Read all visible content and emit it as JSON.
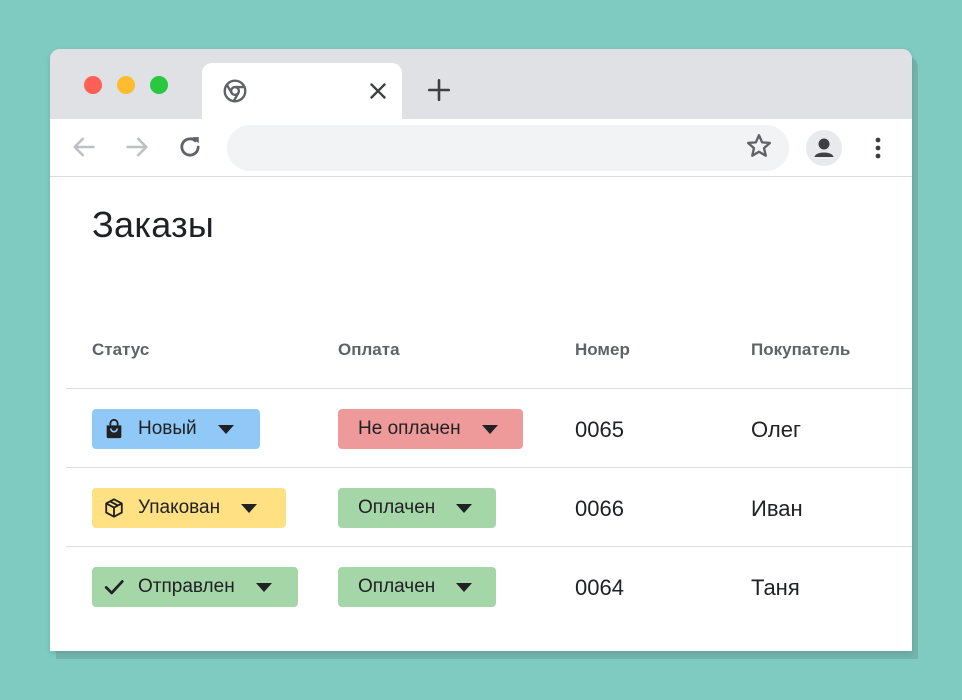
{
  "browser": {
    "tab_favicon": "chrome-icon",
    "tab_close": "close-icon",
    "new_tab": "plus-icon",
    "nav": [
      "back-arrow-icon",
      "forward-arrow-icon",
      "reload-icon"
    ],
    "address_value": "",
    "bookmark": "star-icon",
    "profile": "account-icon",
    "menu": "more-vert-icon"
  },
  "page": {
    "title": "Заказы",
    "columns": [
      "Статус",
      "Оплата",
      "Номер",
      "Покупатель"
    ],
    "rows": [
      {
        "status": {
          "label": "Новый",
          "icon": "shopping-bag-icon",
          "color": "#90c8f8"
        },
        "payment": {
          "label": "Не оплачен",
          "color": "#ef9a9a"
        },
        "number": "0065",
        "customer": "Олег"
      },
      {
        "status": {
          "label": "Упакован",
          "icon": "package-icon",
          "color": "#ffe082"
        },
        "payment": {
          "label": "Оплачен",
          "color": "#a5d6a7"
        },
        "number": "0066",
        "customer": "Иван"
      },
      {
        "status": {
          "label": "Отправлен",
          "icon": "checkmark-icon",
          "color": "#a5d6a7"
        },
        "payment": {
          "label": "Оплачен",
          "color": "#a5d6a7"
        },
        "number": "0064",
        "customer": "Таня"
      }
    ]
  },
  "colors": {
    "background": "#7fcac1",
    "tabbar": "#dfe1e5",
    "traffic_red": "#fe5f57",
    "traffic_yellow": "#febc2e",
    "traffic_green": "#29c840"
  }
}
